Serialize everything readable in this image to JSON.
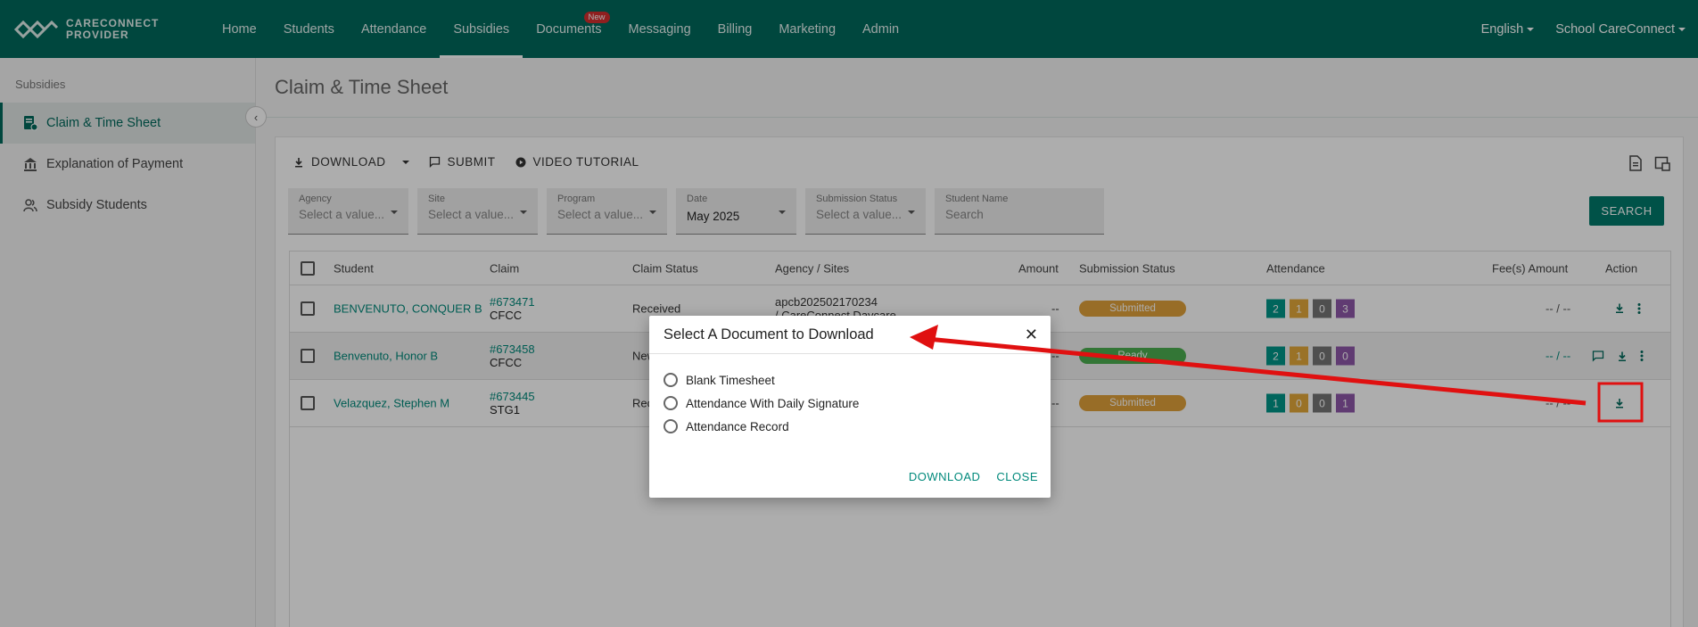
{
  "app": {
    "logo_line1": "CARECONNECT",
    "logo_line2": "PROVIDER"
  },
  "nav": {
    "items": [
      {
        "label": "Home"
      },
      {
        "label": "Students"
      },
      {
        "label": "Attendance"
      },
      {
        "label": "Subsidies",
        "active": true
      },
      {
        "label": "Documents",
        "badge": "New"
      },
      {
        "label": "Messaging"
      },
      {
        "label": "Billing"
      },
      {
        "label": "Marketing"
      },
      {
        "label": "Admin"
      }
    ],
    "language": "English",
    "school": "School CareConnect"
  },
  "sidebar": {
    "title": "Subsidies",
    "items": [
      {
        "label": "Claim & Time Sheet",
        "icon": "claim-sheet-icon",
        "active": true
      },
      {
        "label": "Explanation of Payment",
        "icon": "bank-icon"
      },
      {
        "label": "Subsidy Students",
        "icon": "students-icon"
      }
    ]
  },
  "page": {
    "title": "Claim & Time Sheet"
  },
  "toolbar": {
    "download": "DOWNLOAD",
    "submit": "SUBMIT",
    "video": "VIDEO TUTORIAL"
  },
  "filters": {
    "agency": {
      "label": "Agency",
      "placeholder": "Select a value..."
    },
    "site": {
      "label": "Site",
      "placeholder": "Select a value..."
    },
    "program": {
      "label": "Program",
      "placeholder": "Select a value..."
    },
    "date": {
      "label": "Date",
      "value": "May 2025"
    },
    "submission_status": {
      "label": "Submission Status",
      "placeholder": "Select a value..."
    },
    "student_name": {
      "label": "Student Name",
      "placeholder": "Search"
    },
    "search_button": "SEARCH"
  },
  "table": {
    "headers": {
      "student": "Student",
      "claim": "Claim",
      "claim_status": "Claim Status",
      "agency": "Agency / Sites",
      "amount": "Amount",
      "submission_status": "Submission Status",
      "attendance": "Attendance",
      "fees": "Fee(s) Amount",
      "action": "Action"
    },
    "rows": [
      {
        "student": "BENVENUTO, CONQUER B",
        "claim_no": "#673471",
        "claim_type": "CFCC",
        "claim_status": "Received",
        "agency_line1": "apcb202502170234",
        "agency_line2": "/ CareConnect Daycare",
        "amount": "--",
        "submission": "Submitted",
        "submission_color": "#e0a13a",
        "attendance": [
          "2",
          "1",
          "0",
          "3"
        ],
        "fees": "-- / --"
      },
      {
        "student": "Benvenuto, Honor B",
        "claim_no": "#673458",
        "claim_type": "CFCC",
        "claim_status": "New",
        "agency_line1": "",
        "agency_line2": "",
        "amount": "--",
        "submission": "Ready",
        "submission_color": "#4caf50",
        "attendance": [
          "2",
          "1",
          "0",
          "0"
        ],
        "fees": "-- / --"
      },
      {
        "student": "Velazquez, Stephen M",
        "claim_no": "#673445",
        "claim_type": "STG1",
        "claim_status": "Rec",
        "agency_line1": "",
        "agency_line2": "",
        "amount": "--",
        "submission": "Submitted",
        "submission_color": "#e0a13a",
        "attendance": [
          "1",
          "0",
          "0",
          "1"
        ],
        "fees": "-- / --"
      }
    ]
  },
  "dialog": {
    "title": "Select A Document to Download",
    "options": [
      "Blank Timesheet",
      "Attendance With Daily Signature",
      "Attendance Record"
    ],
    "download": "DOWNLOAD",
    "close": "CLOSE"
  },
  "colors": {
    "brand": "#00695c",
    "accent": "#00897b",
    "annotation": "#e01010",
    "att_green": "#009688",
    "att_yellow": "#e3a83a",
    "att_gray": "#757575",
    "att_purple": "#8e57a8"
  }
}
